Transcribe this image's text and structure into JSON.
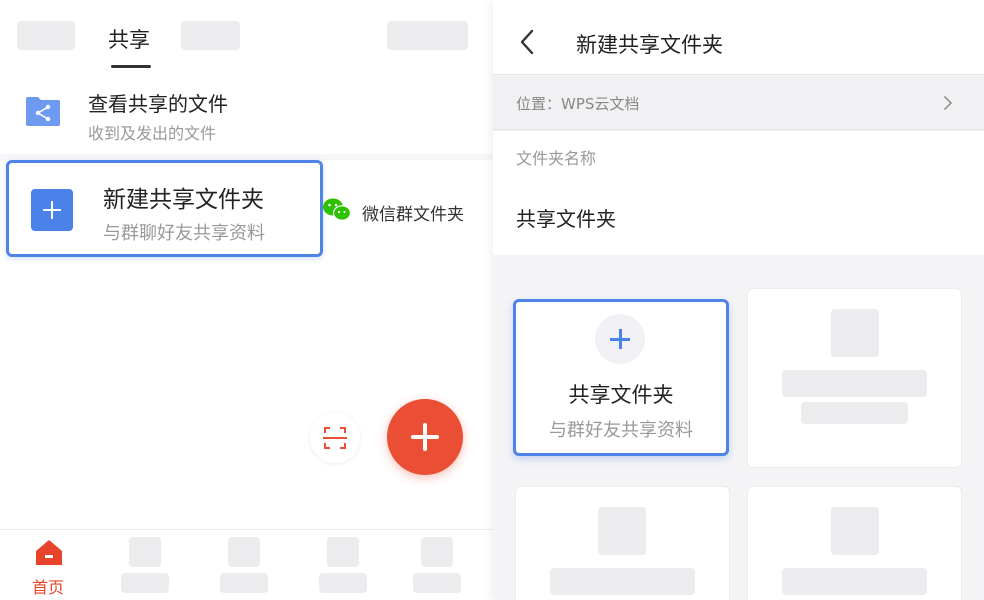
{
  "left_panel": {
    "tabs": [
      {
        "label": "",
        "placeholder": true
      },
      {
        "label": "共享",
        "active": true
      },
      {
        "label": "",
        "placeholder": true
      }
    ],
    "view_shared": {
      "title": "查看共享的文件",
      "subtitle": "收到及发出的文件",
      "icon": "shared-folder-icon"
    },
    "create_shared": {
      "title": "新建共享文件夹",
      "subtitle": "与群聊好友共享资料",
      "icon": "plus-icon"
    },
    "wechat": {
      "label": "微信群文件夹",
      "icon": "wechat-icon"
    },
    "scan_button_icon": "scan-icon",
    "fab_icon": "plus-icon",
    "bottom_nav": {
      "items": [
        {
          "label": "首页",
          "active": true,
          "icon": "home-icon"
        }
      ]
    }
  },
  "right_panel": {
    "title": "新建共享文件夹",
    "back_icon": "chevron-left-icon",
    "location": {
      "text": "位置：WPS云文档",
      "icon": "chevron-right-icon"
    },
    "folder_name": {
      "label": "文件夹名称",
      "value": "共享文件夹"
    },
    "templates": [
      {
        "title": "共享文件夹",
        "subtitle": "与群好友共享资料",
        "selected": true,
        "icon": "plus-icon"
      }
    ]
  },
  "colors": {
    "accent_blue": "#4f84e6",
    "fab_red": "#ea4e34",
    "nav_active": "#e8432b",
    "wechat_green": "#2dc100"
  }
}
